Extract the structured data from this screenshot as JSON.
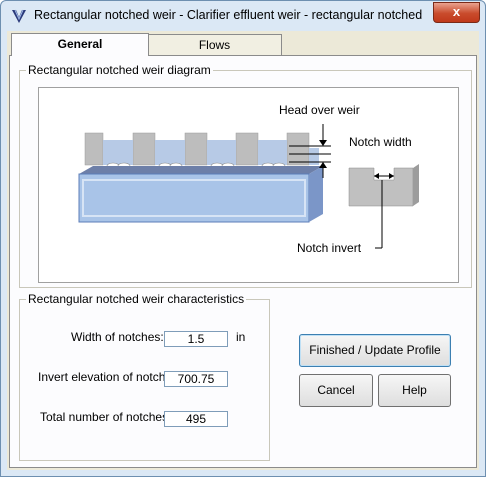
{
  "window": {
    "title": "Rectangular notched weir - Clarifier effluent weir - rectangular notched",
    "close_glyph": "x"
  },
  "tabs": [
    {
      "label": "General",
      "active": true
    },
    {
      "label": "Flows",
      "active": false
    }
  ],
  "diagram": {
    "group_label": "Rectangular notched weir diagram",
    "labels": {
      "head_over_weir": "Head over weir",
      "notch_width": "Notch width",
      "notch_invert": "Notch invert"
    }
  },
  "characteristics": {
    "group_label": "Rectangular notched weir characteristics",
    "width_label": "Width of notches:",
    "width_value": "1.5",
    "width_unit": "in",
    "invert_label": "Invert elevation of notch:",
    "invert_value": "700.75",
    "count_label": "Total number of notches:",
    "count_value": "495"
  },
  "buttons": {
    "finish": "Finished / Update Profile",
    "cancel": "Cancel",
    "help": "Help"
  },
  "colors": {
    "close_button": "#c94b2c",
    "water": "#a9c4e8",
    "weir_gray": "#b8b8b8"
  }
}
